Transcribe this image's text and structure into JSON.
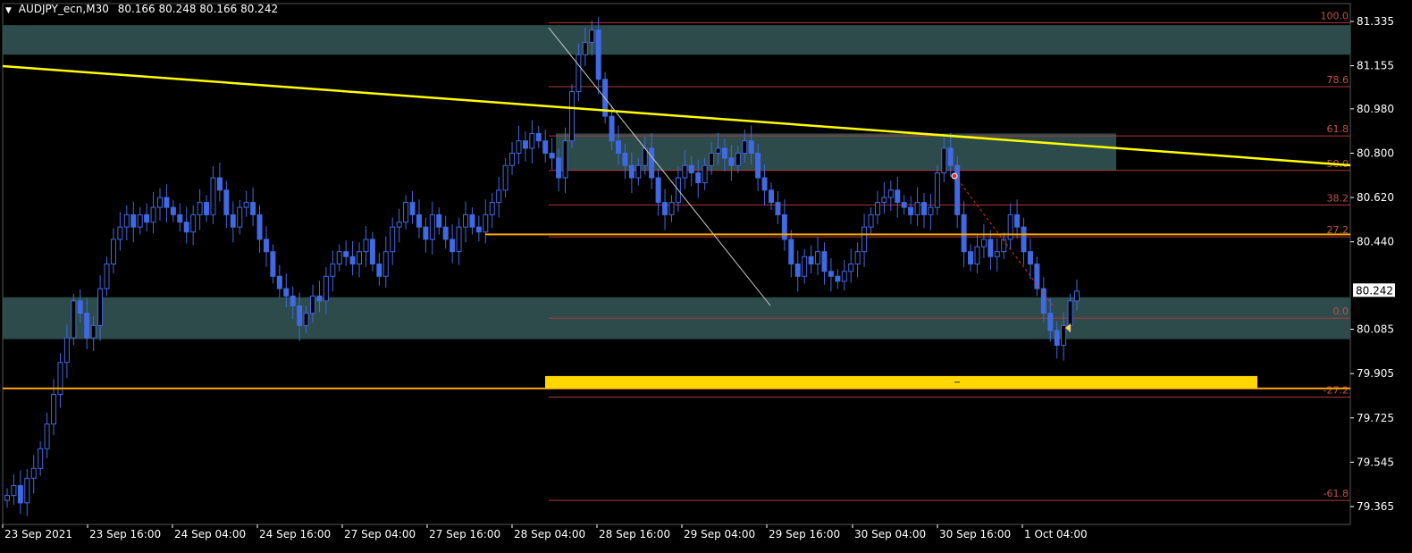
{
  "header": {
    "symbol": "AUDJPY_ecn,M30",
    "ohlc": "80.166 80.248 80.166 80.242"
  },
  "colors": {
    "background": "#000000",
    "candle": "#4169e1",
    "zone": "#2f4f4f",
    "trendline": "#ffff00",
    "fib": "#b03838",
    "horizontal_line": "#ffa500",
    "target_box": "#ffd700",
    "axis": "#ffffff"
  },
  "current_price": "80.242",
  "chart_data": {
    "type": "candlestick",
    "price_axis_labels": [
      "81.335",
      "81.155",
      "80.980",
      "80.800",
      "80.620",
      "80.440",
      "80.260",
      "80.085",
      "79.905",
      "79.725",
      "79.545",
      "79.365"
    ],
    "time_axis_labels": [
      "23 Sep 2021",
      "23 Sep 16:00",
      "24 Sep 04:00",
      "24 Sep 16:00",
      "27 Sep 04:00",
      "27 Sep 16:00",
      "28 Sep 04:00",
      "28 Sep 16:00",
      "29 Sep 04:00",
      "29 Sep 16:00",
      "30 Sep 04:00",
      "30 Sep 16:00",
      "1 Oct 04:00"
    ],
    "fib_levels": [
      {
        "label": "100.0",
        "price": 81.33
      },
      {
        "label": "78.6",
        "price": 81.07
      },
      {
        "label": "61.8",
        "price": 80.87
      },
      {
        "label": "50.0",
        "price": 80.73
      },
      {
        "label": "38.2",
        "price": 80.59
      },
      {
        "label": "27.2",
        "price": 80.46
      },
      {
        "label": "0.0",
        "price": 80.13
      },
      {
        "label": "-27.2",
        "price": 79.81
      },
      {
        "label": "-61.8",
        "price": 79.39
      }
    ],
    "zones": [
      {
        "name": "supply-zone",
        "top": 81.32,
        "bottom": 81.2
      },
      {
        "name": "mid-zone",
        "top": 80.88,
        "bottom": 80.73
      },
      {
        "name": "demand-zone",
        "top": 80.215,
        "bottom": 80.045
      }
    ],
    "horizontal_lines": [
      {
        "name": "orange-line-upper",
        "price": 80.47
      },
      {
        "name": "orange-line-lower",
        "price": 79.845
      }
    ],
    "target_box": {
      "top": 79.895,
      "bottom": 79.845
    },
    "candles_close": [
      79.41,
      79.45,
      79.38,
      79.48,
      79.52,
      79.6,
      79.7,
      79.82,
      79.95,
      80.05,
      80.2,
      80.15,
      80.05,
      80.1,
      80.25,
      80.35,
      80.45,
      80.5,
      80.55,
      80.5,
      80.55,
      80.52,
      80.58,
      80.62,
      80.58,
      80.55,
      80.52,
      80.48,
      80.55,
      80.6,
      80.55,
      80.7,
      80.65,
      80.55,
      80.5,
      80.58,
      80.6,
      80.55,
      80.45,
      80.4,
      80.3,
      80.25,
      80.22,
      80.18,
      80.1,
      80.15,
      80.22,
      80.2,
      80.3,
      80.35,
      80.4,
      80.38,
      80.35,
      80.4,
      80.45,
      80.35,
      80.3,
      80.4,
      80.5,
      80.52,
      80.6,
      80.55,
      80.5,
      80.45,
      80.55,
      80.5,
      80.45,
      80.4,
      80.5,
      80.55,
      80.5,
      80.48,
      80.55,
      80.6,
      80.65,
      80.75,
      80.8,
      80.85,
      80.82,
      80.88,
      80.85,
      80.8,
      80.78,
      80.7,
      80.85,
      81.05,
      81.2,
      81.25,
      81.3,
      81.1,
      80.95,
      80.85,
      80.8,
      80.75,
      80.7,
      80.75,
      80.82,
      80.7,
      80.6,
      80.55,
      80.6,
      80.7,
      80.75,
      80.72,
      80.68,
      80.75,
      80.8,
      80.82,
      80.78,
      80.75,
      80.8,
      80.85,
      80.8,
      80.7,
      80.65,
      80.6,
      80.55,
      80.45,
      80.35,
      80.3,
      80.38,
      80.35,
      80.4,
      80.32,
      80.3,
      80.28,
      80.32,
      80.35,
      80.4,
      80.5,
      80.55,
      80.6,
      80.62,
      80.65,
      80.6,
      80.58,
      80.55,
      80.6,
      80.55,
      80.58,
      80.72,
      80.82,
      80.75,
      80.55,
      80.4,
      80.35,
      80.42,
      80.45,
      80.38,
      80.4,
      80.45,
      80.55,
      80.5,
      80.4,
      80.35,
      80.25,
      80.15,
      80.08,
      80.02,
      80.1,
      80.2,
      80.24
    ]
  }
}
